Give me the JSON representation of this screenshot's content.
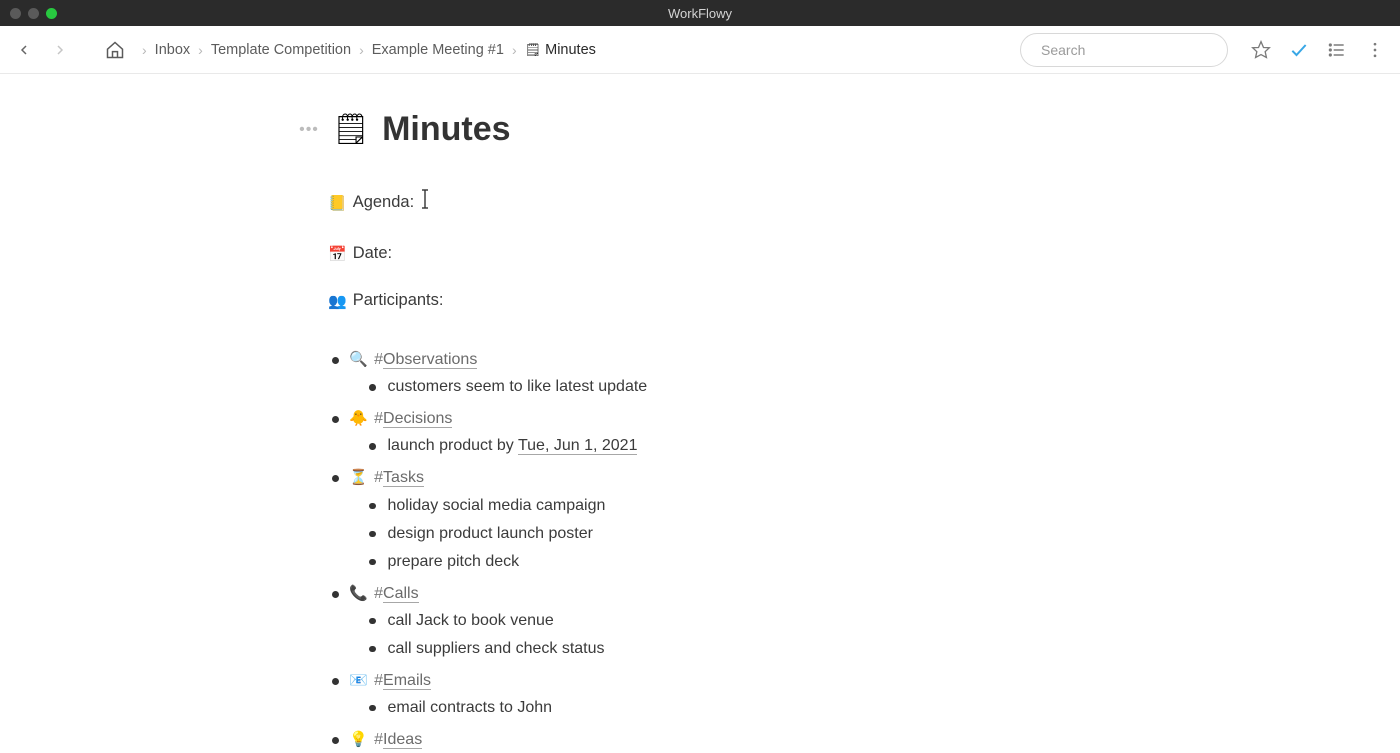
{
  "app": {
    "title": "WorkFlowy"
  },
  "breadcrumbs": [
    {
      "label": "Inbox"
    },
    {
      "label": "Template Competition"
    },
    {
      "label": "Example Meeting #1"
    },
    {
      "label": "Minutes",
      "emoji": "🗒"
    }
  ],
  "search": {
    "placeholder": "Search"
  },
  "page": {
    "emoji": "🗒",
    "title": "Minutes"
  },
  "fields": {
    "agenda": {
      "emoji": "📒",
      "label": "Agenda:"
    },
    "date": {
      "emoji": "📅",
      "label": "Date:"
    },
    "participants": {
      "emoji": "👥",
      "label": "Participants:"
    }
  },
  "sections": [
    {
      "emoji": "🔍",
      "tag": "Observations",
      "items": [
        "customers seem to like latest update"
      ]
    },
    {
      "emoji": "🐥",
      "tag": "Decisions",
      "items": [],
      "items_rich": [
        {
          "prefix": "launch product by ",
          "date": "Tue, Jun 1, 2021"
        }
      ]
    },
    {
      "emoji": "⏳",
      "tag": "Tasks",
      "items": [
        "holiday social media campaign",
        "design product launch poster",
        "prepare pitch deck"
      ]
    },
    {
      "emoji": "📞",
      "tag": "Calls",
      "items": [
        "call Jack to book venue",
        "call suppliers and check status"
      ]
    },
    {
      "emoji": "📧",
      "tag": "Emails",
      "items": [
        "email contracts to John"
      ]
    },
    {
      "emoji": "💡",
      "tag": "Ideas",
      "items": []
    }
  ]
}
